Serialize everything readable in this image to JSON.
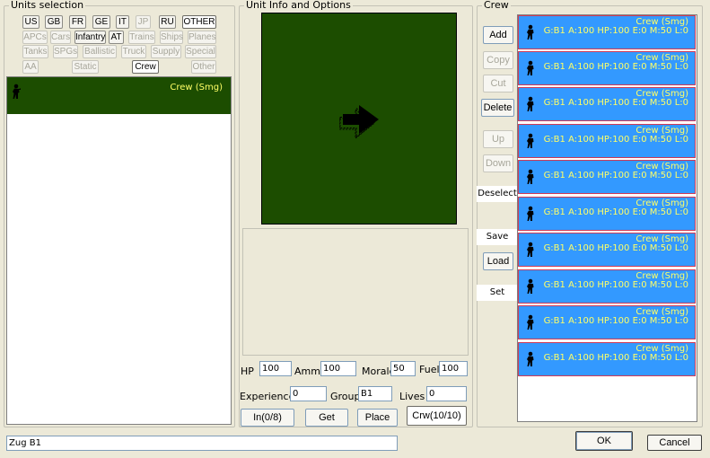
{
  "units_selection": {
    "title": "Units selection",
    "nations": [
      "US",
      "GB",
      "FR",
      "GE",
      "IT",
      "JP",
      "RU",
      "OTHER"
    ],
    "categories_row1": [
      "APCs",
      "Cars",
      "Infantry",
      "AT",
      "Trains",
      "Ships",
      "Planes"
    ],
    "categories_row2": [
      "Tanks",
      "SPGs",
      "Ballistic",
      "Truck",
      "Supply",
      "Special"
    ],
    "categories_row3": [
      "AA",
      "Static",
      "Crew",
      "Other"
    ],
    "list": [
      {
        "name": "Crew (Smg)"
      }
    ]
  },
  "unit_info": {
    "title": "Unit Info and Options",
    "fields": {
      "hp_label": "HP",
      "hp_value": "100",
      "ammo_label": "Ammo",
      "ammo_value": "100",
      "morale_label": "Morale",
      "morale_value": "50",
      "fuel_label": "Fuel",
      "fuel_value": "100",
      "experience_label": "Experience",
      "experience_value": "0",
      "group_label": "Group",
      "group_value": "B1",
      "lives_label": "Lives",
      "lives_value": "0"
    },
    "buttons": {
      "in": "In(0/8)",
      "get": "Get",
      "place": "Place",
      "crew": "Crw(10/10)"
    }
  },
  "crew": {
    "title": "Crew",
    "buttons": {
      "add": "Add",
      "copy": "Copy",
      "cut": "Cut",
      "delete": "Delete",
      "up": "Up",
      "down": "Down",
      "deselect": "Deselect",
      "save": "Save",
      "load": "Load",
      "set": "Set"
    },
    "items": [
      {
        "name": "Crew (Smg)",
        "stats": "G:B1 A:100 HP:100 E:0 M:50 L:0"
      },
      {
        "name": "Crew (Smg)",
        "stats": "G:B1 A:100 HP:100 E:0 M:50 L:0"
      },
      {
        "name": "Crew (Smg)",
        "stats": "G:B1 A:100 HP:100 E:0 M:50 L:0"
      },
      {
        "name": "Crew (Smg)",
        "stats": "G:B1 A:100 HP:100 E:0 M:50 L:0"
      },
      {
        "name": "Crew (Smg)",
        "stats": "G:B1 A:100 HP:100 E:0 M:50 L:0"
      },
      {
        "name": "Crew (Smg)",
        "stats": "G:B1 A:100 HP:100 E:0 M:50 L:0"
      },
      {
        "name": "Crew (Smg)",
        "stats": "G:B1 A:100 HP:100 E:0 M:50 L:0"
      },
      {
        "name": "Crew (Smg)",
        "stats": "G:B1 A:100 HP:100 E:0 M:50 L:0"
      },
      {
        "name": "Crew (Smg)",
        "stats": "G:B1 A:100 HP:100 E:0 M:50 L:0"
      },
      {
        "name": "Crew (Smg)",
        "stats": "G:B1 A:100 HP:100 E:0 M:50 L:0"
      }
    ]
  },
  "footer": {
    "name_value": "Zug B1",
    "ok": "OK",
    "cancel": "Cancel"
  },
  "colors": {
    "preview_bg": "#1c4d00",
    "crew_item_bg": "#3399ff",
    "crew_text": "#ffff66"
  }
}
